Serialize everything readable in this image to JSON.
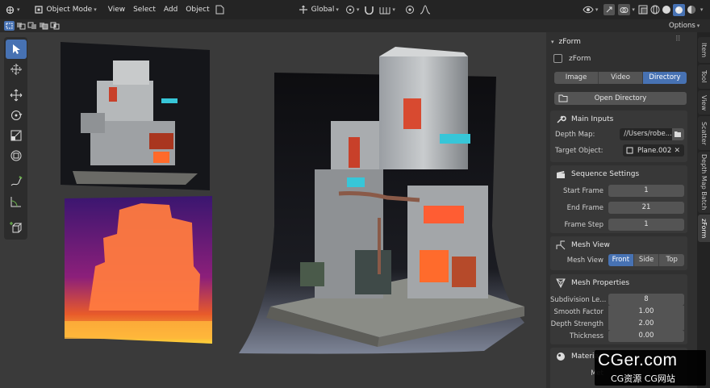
{
  "header": {
    "mode": "Object Mode",
    "menu": [
      "View",
      "Select",
      "Add",
      "Object"
    ],
    "transform_orientation": "Global",
    "options_label": "Options"
  },
  "panel": {
    "title": "zForm",
    "enable_label": "zForm",
    "source_tabs": [
      {
        "label": "Image",
        "active": false
      },
      {
        "label": "Video",
        "active": false
      },
      {
        "label": "Directory",
        "active": true
      }
    ],
    "open_directory_label": "Open Directory",
    "main_inputs": {
      "title": "Main Inputs",
      "depth_map_label": "Depth Map:",
      "depth_map_value": "//Users/robe...",
      "target_object_label": "Target Object:",
      "target_object_value": "Plane.002"
    },
    "sequence": {
      "title": "Sequence Settings",
      "rows": [
        {
          "label": "Start Frame",
          "value": "1"
        },
        {
          "label": "End Frame",
          "value": "21"
        },
        {
          "label": "Frame Step",
          "value": "1"
        }
      ]
    },
    "mesh_view": {
      "title": "Mesh View",
      "label": "Mesh View",
      "options": [
        {
          "label": "Front",
          "active": true
        },
        {
          "label": "Side",
          "active": false
        },
        {
          "label": "Top",
          "active": false
        }
      ]
    },
    "mesh_properties": {
      "title": "Mesh Properties",
      "rows": [
        {
          "label": "Subdivision Le...",
          "value": "8"
        },
        {
          "label": "Smooth Factor",
          "value": "1.00"
        },
        {
          "label": "Depth Strength",
          "value": "2.00"
        },
        {
          "label": "Thickness",
          "value": "0.00"
        }
      ]
    },
    "material": {
      "title": "Materia",
      "row_label": "Met"
    }
  },
  "side_tabs": [
    "Item",
    "Tool",
    "View",
    "Scatter",
    "Depth Map Batch",
    "zForm"
  ],
  "active_side_tab": "zForm",
  "watermark": {
    "title": "CGer.com",
    "subtitle": "CG资源 CG网站"
  },
  "colors": {
    "accent": "#4772b3",
    "panel": "#303030",
    "viewport": "#3a3a3a"
  }
}
